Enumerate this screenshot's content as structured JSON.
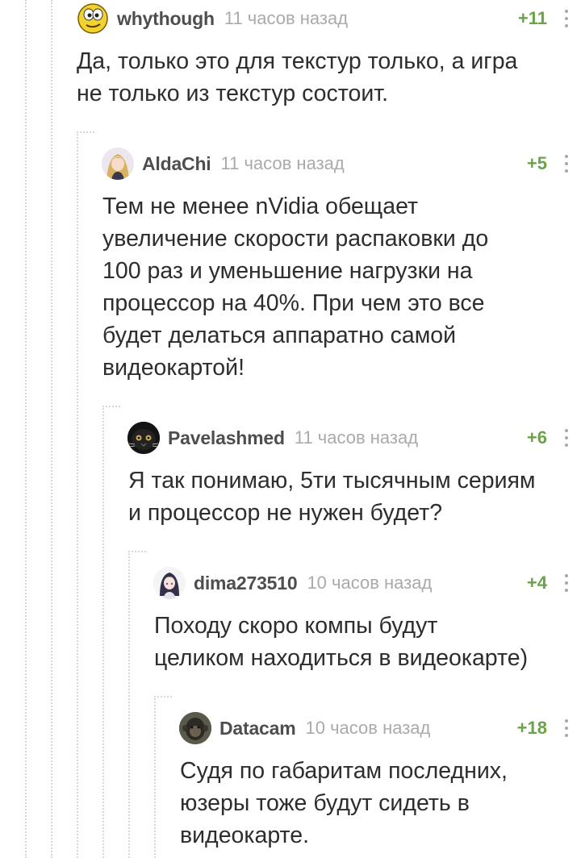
{
  "comments": [
    {
      "username": "whythough",
      "time": "11 часов назад",
      "rating": "+11",
      "avatar": "yellow-cartoon-face",
      "text": "Да, только это для текстур только, а игра\nне только из текстур состоит."
    },
    {
      "username": "AldaChi",
      "time": "11 часов назад",
      "rating": "+5",
      "avatar": "anime-girl-blonde",
      "text": "Тем не менее nVidia обещает\nувеличение скорости распаковки до\n100 раз и уменьшение нагрузки на\nпроцессор на 40%. При чем это все\nбудет делаться аппаратно самой\nвидеокартой!"
    },
    {
      "username": "Pavelashmed",
      "time": "11 часов назад",
      "rating": "+6",
      "avatar": "black-cat",
      "text": "Я так понимаю, 5ти тысячным сериям\nи процессор не нужен будет?"
    },
    {
      "username": "dima273510",
      "time": "10 часов назад",
      "rating": "+4",
      "avatar": "anime-girl-dark",
      "text": "Походу скоро компы будут\nцеликом находиться в видеокарте)"
    },
    {
      "username": "Datacam",
      "time": "10 часов назад",
      "rating": "+18",
      "avatar": "monkey-photo",
      "text": "Судя по габаритам последних,\nюзеры тоже будут сидеть в\nвидеокарте."
    }
  ],
  "colors": {
    "rating": "#6ba349",
    "username": "#4e4e4e",
    "time": "#aaaaaa",
    "thread_line": "#d6d6d6"
  }
}
